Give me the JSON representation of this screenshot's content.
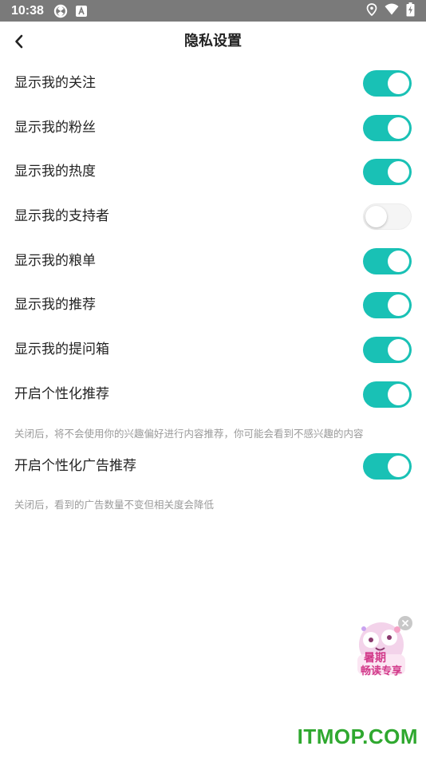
{
  "status_bar": {
    "time": "10:38",
    "left_icons": [
      "sync-icon",
      "a-icon"
    ],
    "right_icons": [
      "location-icon",
      "wifi-icon",
      "battery-charging-icon"
    ]
  },
  "nav": {
    "back_icon": "chevron-left-icon",
    "title": "隐私设置"
  },
  "settings": [
    {
      "label": "显示我的关注",
      "on": true
    },
    {
      "label": "显示我的粉丝",
      "on": true
    },
    {
      "label": "显示我的热度",
      "on": true
    },
    {
      "label": "显示我的支持者",
      "on": false
    },
    {
      "label": "显示我的粮单",
      "on": true
    },
    {
      "label": "显示我的推荐",
      "on": true
    },
    {
      "label": "显示我的提问箱",
      "on": true
    },
    {
      "label": "开启个性化推荐",
      "on": true,
      "hint": "关闭后，将不会使用你的兴趣偏好进行内容推荐，你可能会看到不感兴趣的内容"
    },
    {
      "label": "开启个性化广告推荐",
      "on": true,
      "hint": "关闭后，看到的广告数量不变但相关度会降低"
    }
  ],
  "floating_badge": {
    "text_line1": "暑期",
    "text_line2": "畅读专享"
  },
  "watermark": "ITMOP.COM",
  "colors": {
    "toggle_on": "#19c1b5",
    "toggle_off": "#f5f5f5",
    "status_bar": "#7a7a7a",
    "watermark": "#2fa82f"
  }
}
